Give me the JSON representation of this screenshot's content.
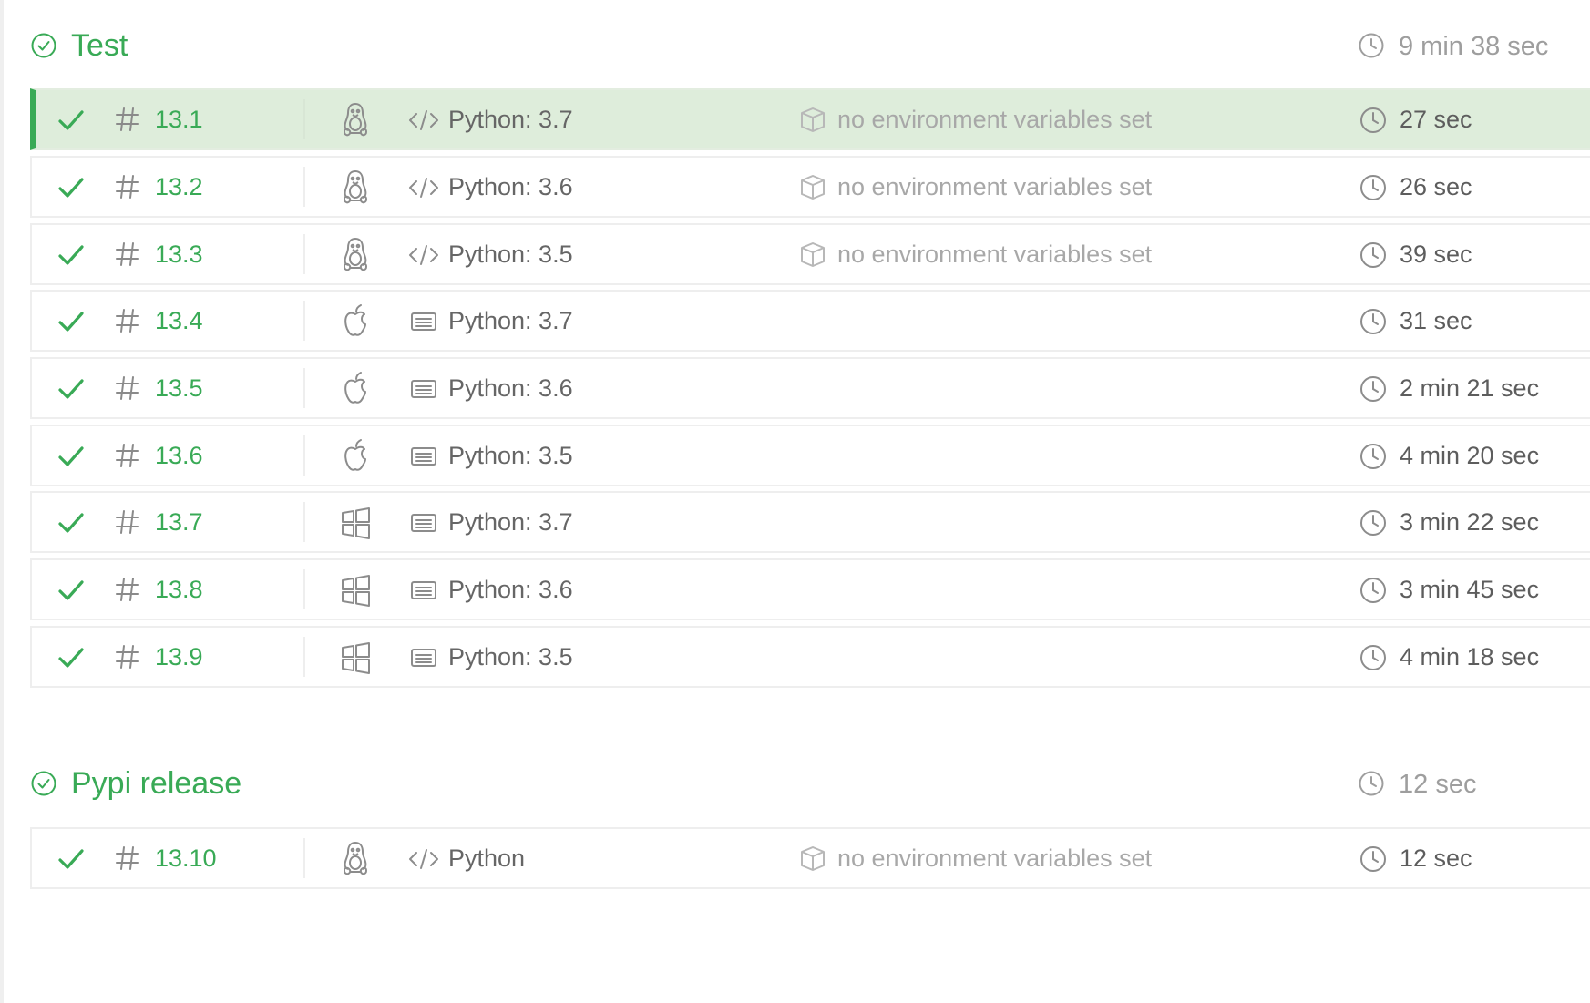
{
  "colors": {
    "accent": "#39aa56",
    "active_row_bg": "#deeddb",
    "muted_text": "#a8a8a8",
    "body_text": "#666666"
  },
  "stages": [
    {
      "title": "Test",
      "duration": "9 min 38 sec",
      "status_icon": "check-circle-icon",
      "jobs": [
        {
          "number": "13.1",
          "os": "linux",
          "os_icon": "linux-penguin-icon",
          "lang_icon": "code-icon",
          "language": "Python: 3.7",
          "env": "no environment variables set",
          "duration": "27 sec",
          "active": true
        },
        {
          "number": "13.2",
          "os": "linux",
          "os_icon": "linux-penguin-icon",
          "lang_icon": "code-icon",
          "language": "Python: 3.6",
          "env": "no environment variables set",
          "duration": "26 sec",
          "active": false
        },
        {
          "number": "13.3",
          "os": "linux",
          "os_icon": "linux-penguin-icon",
          "lang_icon": "code-icon",
          "language": "Python: 3.5",
          "env": "no environment variables set",
          "duration": "39 sec",
          "active": false
        },
        {
          "number": "13.4",
          "os": "osx",
          "os_icon": "apple-icon",
          "lang_icon": "terminal-icon",
          "language": "Python: 3.7",
          "env": "",
          "duration": "31 sec",
          "active": false
        },
        {
          "number": "13.5",
          "os": "osx",
          "os_icon": "apple-icon",
          "lang_icon": "terminal-icon",
          "language": "Python: 3.6",
          "env": "",
          "duration": "2 min 21 sec",
          "active": false
        },
        {
          "number": "13.6",
          "os": "osx",
          "os_icon": "apple-icon",
          "lang_icon": "terminal-icon",
          "language": "Python: 3.5",
          "env": "",
          "duration": "4 min 20 sec",
          "active": false
        },
        {
          "number": "13.7",
          "os": "windows",
          "os_icon": "windows-icon",
          "lang_icon": "terminal-icon",
          "language": "Python: 3.7",
          "env": "",
          "duration": "3 min 22 sec",
          "active": false
        },
        {
          "number": "13.8",
          "os": "windows",
          "os_icon": "windows-icon",
          "lang_icon": "terminal-icon",
          "language": "Python: 3.6",
          "env": "",
          "duration": "3 min 45 sec",
          "active": false
        },
        {
          "number": "13.9",
          "os": "windows",
          "os_icon": "windows-icon",
          "lang_icon": "terminal-icon",
          "language": "Python: 3.5",
          "env": "",
          "duration": "4 min 18 sec",
          "active": false
        }
      ]
    },
    {
      "title": "Pypi release",
      "duration": "12 sec",
      "status_icon": "check-circle-icon",
      "jobs": [
        {
          "number": "13.10",
          "os": "linux",
          "os_icon": "linux-penguin-icon",
          "lang_icon": "code-icon",
          "language": "Python",
          "env": "no environment variables set",
          "duration": "12 sec",
          "active": false
        }
      ]
    }
  ]
}
